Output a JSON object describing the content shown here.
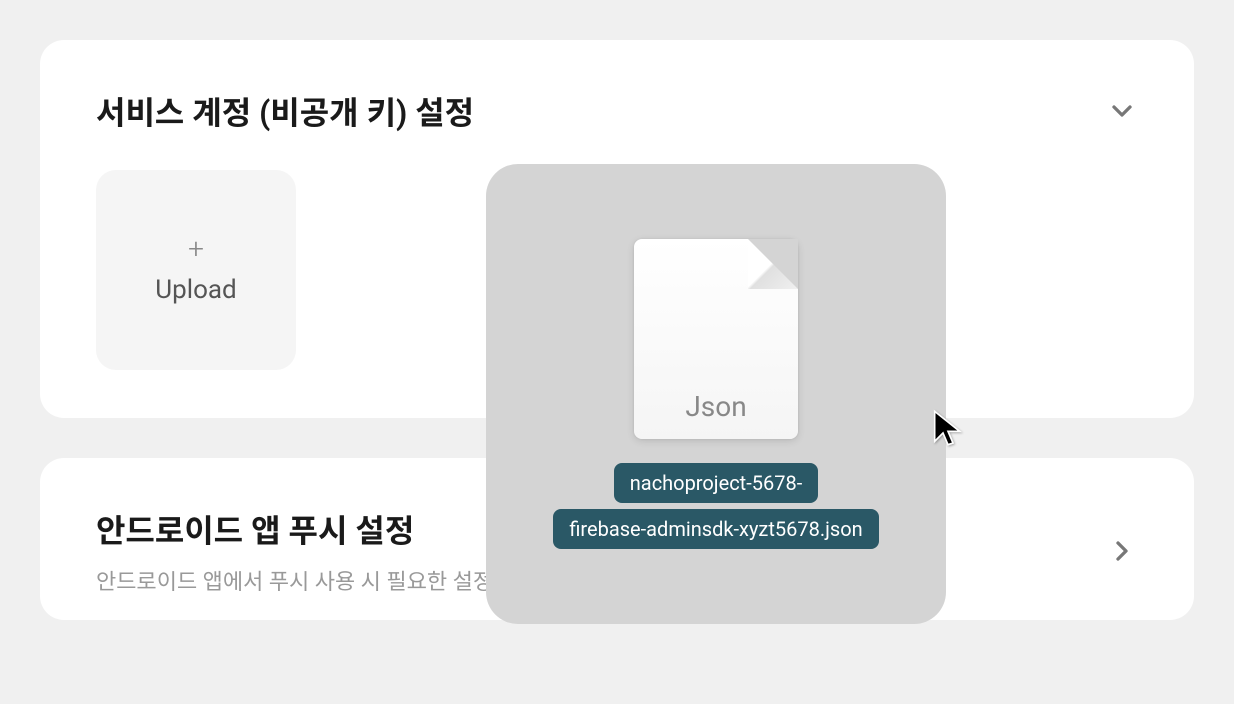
{
  "cards": {
    "serviceAccount": {
      "title": "서비스 계정 (비공개 키) 설정",
      "upload": {
        "label": "Upload"
      }
    },
    "androidPush": {
      "title": "안드로이드 앱 푸시 설정",
      "subtitle": "안드로이드 앱에서 푸시 사용 시 필요한 설정입니다."
    }
  },
  "dragOverlay": {
    "fileTypeLabel": "Json",
    "filename": {
      "line1": "nachoproject-5678-",
      "line2": "firebase-adminsdk-xyzt5678.json"
    }
  }
}
